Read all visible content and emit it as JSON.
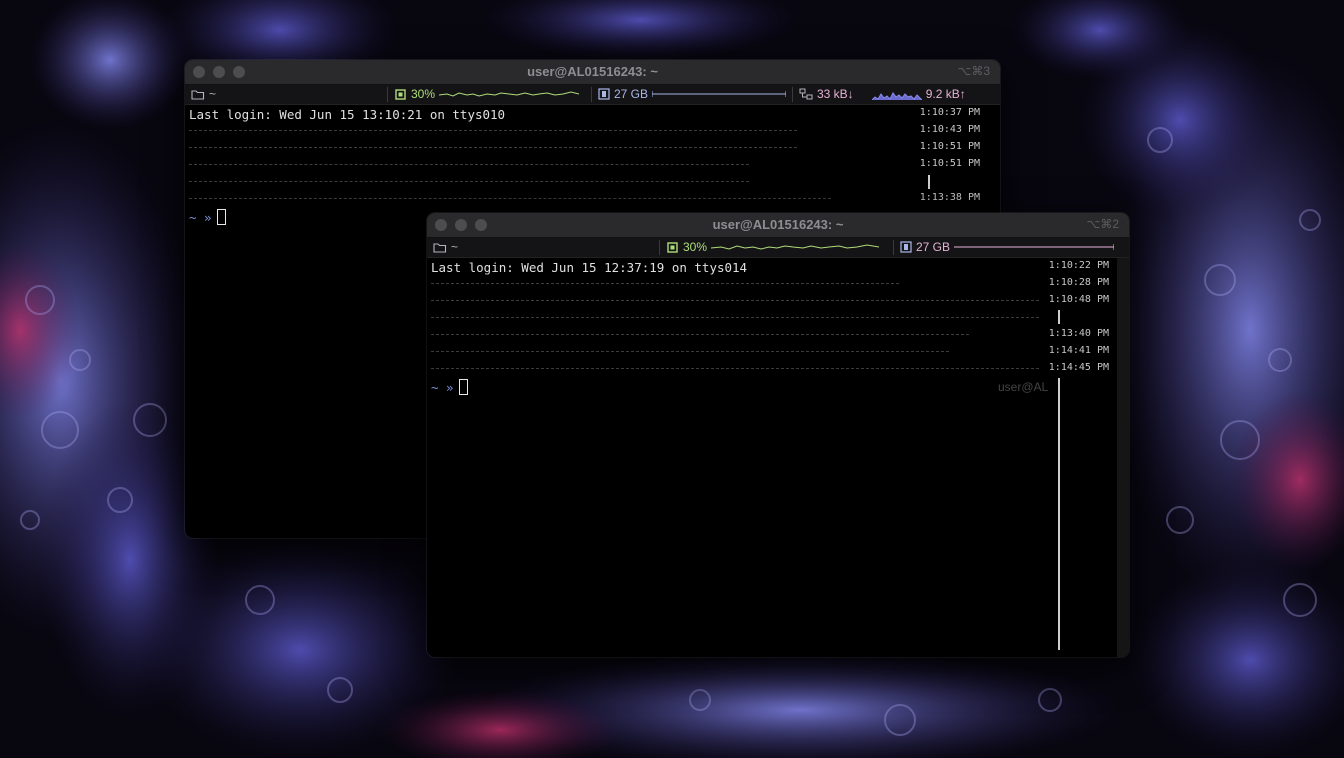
{
  "window1": {
    "title": "user@AL01516243: ~",
    "shortcut": "⌥⌘3",
    "status": {
      "folder": "~",
      "cpu": "30%",
      "memory": "27 GB",
      "net_down": "33 kB↓",
      "net_up": "9.2 kB↑"
    },
    "login": "Last login: Wed Jun 15 13:10:21 on ttys010",
    "prompt": "~ »",
    "timestamps": [
      "1:10:37 PM",
      "1:10:43 PM",
      "1:10:51 PM",
      "1:10:51 PM",
      "1:13:38 PM"
    ]
  },
  "window2": {
    "title": "user@AL01516243: ~",
    "shortcut": "⌥⌘2",
    "status": {
      "folder": "~",
      "cpu": "30%",
      "memory": "27 GB"
    },
    "login": "Last login: Wed Jun 15 12:37:19 on ttys014",
    "prompt": "~ »",
    "ghost_text": "user@AL",
    "timestamps": [
      "1:10:22 PM",
      "1:10:28 PM",
      "1:10:48 PM",
      "1:13:40 PM",
      "1:14:41 PM",
      "1:14:45 PM"
    ]
  },
  "colors": {
    "cpu": "#b0dd7a",
    "memory": "#a9b7e8",
    "network": "#e6b2d4",
    "prompt": "#7e93d8"
  },
  "icons": [
    "folder-icon",
    "cpu-chip-icon",
    "memory-icon",
    "network-icon"
  ]
}
